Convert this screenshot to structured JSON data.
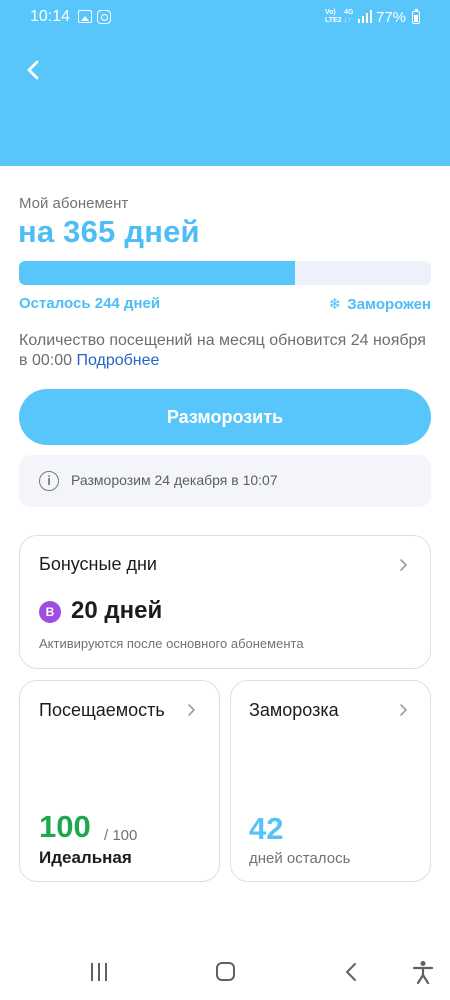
{
  "status_bar": {
    "time": "10:14",
    "network_volte": "Vo)\nLTE2",
    "network_4g": "4G\n↓↑",
    "battery": "77%"
  },
  "header": {
    "back_icon": "chevron-left-icon",
    "background_color": "#58c6fb"
  },
  "subscription": {
    "label": "Мой абонемент",
    "title": "на 365 дней",
    "progress_fraction": 0.67,
    "remaining": "Осталось 244 дней",
    "status": "Заморожен",
    "status_icon": "❄"
  },
  "visits_note": {
    "text": "Количество посещений на месяц обновится 24 ноября в 00:00 ",
    "link": "Подробнее"
  },
  "actions": {
    "unfreeze_label": "Разморозить"
  },
  "info": {
    "icon": "i",
    "text": "Разморозим 24 декабря в 10:07"
  },
  "bonus_card": {
    "title": "Бонусные дни",
    "badge": "B",
    "value": "20 дней",
    "caption": "Активируются после основного абонемента"
  },
  "attendance_card": {
    "title": "Посещаемость",
    "value": "100",
    "max": "/ 100",
    "label": "Идеальная"
  },
  "freeze_card": {
    "title": "Заморозка",
    "value": "42",
    "label": "дней осталось"
  },
  "colors": {
    "accent": "#58c6fb",
    "success": "#1ea84e",
    "link": "#2563c9",
    "bonus_badge": "#a04de2"
  }
}
